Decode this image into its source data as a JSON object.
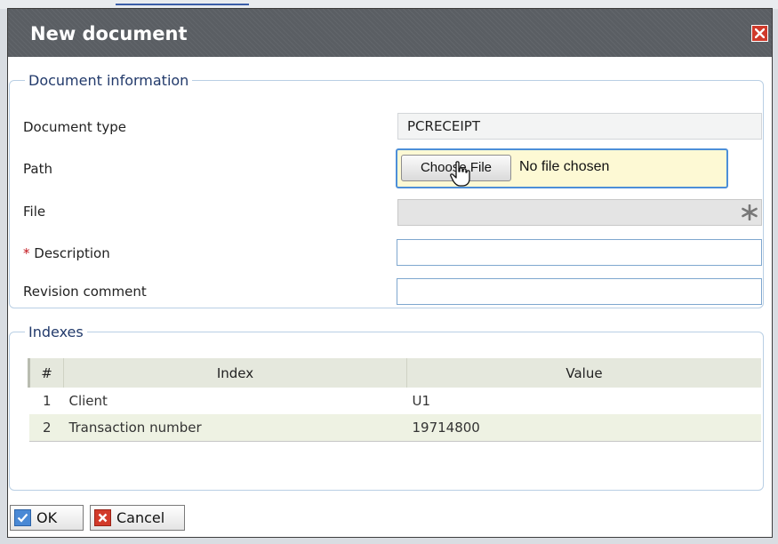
{
  "dialog": {
    "title": "New document"
  },
  "document_info": {
    "legend": "Document information",
    "document_type_label": "Document type",
    "document_type_value": "PCRECEIPT",
    "path_label": "Path",
    "choose_file_label": "Choose File",
    "no_file_text": "No file chosen",
    "file_label": "File",
    "description_required_marker": "*",
    "description_label": "Description",
    "description_value": "",
    "revision_comment_label": "Revision comment",
    "revision_comment_value": ""
  },
  "indexes": {
    "legend": "Indexes",
    "columns": [
      "#",
      "Index",
      "Value"
    ],
    "rows": [
      {
        "num": "1",
        "index": "Client",
        "value": "U1"
      },
      {
        "num": "2",
        "index": "Transaction number",
        "value": "19714800"
      }
    ]
  },
  "footer": {
    "ok_label": "OK",
    "cancel_label": "Cancel"
  },
  "colors": {
    "accent": "#4d8fd8",
    "close": "#cf3a2b",
    "required": "#c2141b"
  }
}
